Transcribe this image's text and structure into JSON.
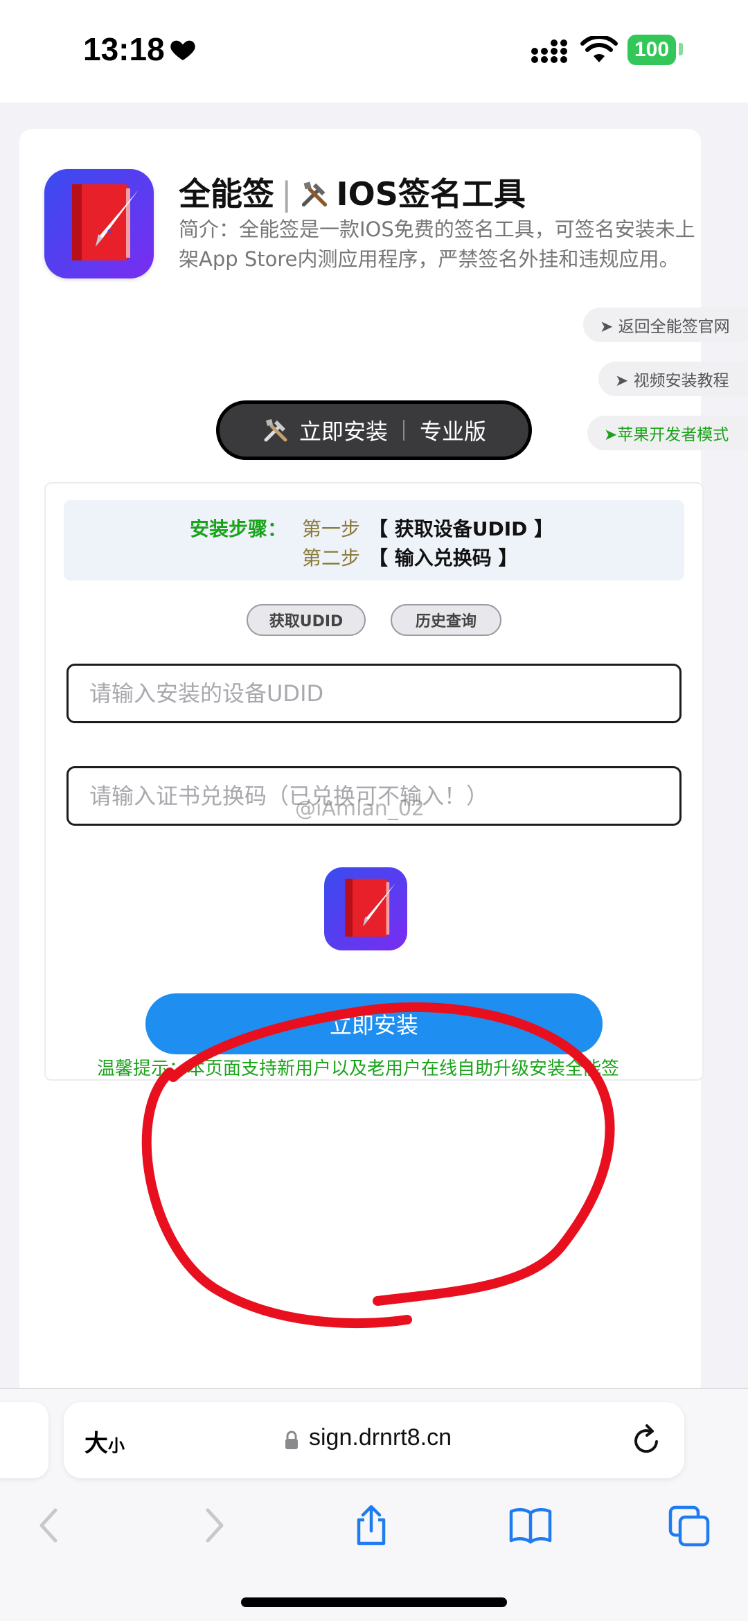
{
  "status_bar": {
    "time": "13:18",
    "battery": "100",
    "battery_color": "#33c759"
  },
  "app": {
    "title": "全能签",
    "title_separator": "|",
    "subtitle": "IOS签名工具",
    "description": "简介：全能签是一款IOS免费的签名工具，可签名安装未上架App Store内测应用程序，严禁签名外挂和违规应用。",
    "icon": "pen-book-icon"
  },
  "side_links": [
    {
      "label": "➤ 返回全能签官网"
    },
    {
      "label": "➤ 视频安装教程"
    },
    {
      "label": "➤苹果开发者模式"
    }
  ],
  "install_pill": {
    "label": "立即安装",
    "edition": "专业版",
    "icon": "tools-icon"
  },
  "steps": {
    "label": "安装步骤：",
    "items": [
      {
        "num": "第一步",
        "text": "【 获取设备UDID 】"
      },
      {
        "num": "第二步",
        "text": "【 输入兑换码 】"
      }
    ]
  },
  "actions": {
    "get_udid": "获取UDID",
    "history": "历史查询"
  },
  "form": {
    "udid_placeholder": "请输入安装的设备UDID",
    "code_placeholder": "请输入证书兑换码（已兑换可不输入！）",
    "submit": "立即安装"
  },
  "watermark": "@iAmlan_02",
  "tip": "温馨提示：本页面支持新用户以及老用户在线自助升级安装全能签",
  "browser": {
    "text_size_big": "大",
    "text_size_small": "小",
    "url": "sign.drnrt8.cn"
  },
  "colors": {
    "accent_blue": "#1e8ef0",
    "green_text": "#1aa31a",
    "annotation_red": "#e8101e"
  }
}
